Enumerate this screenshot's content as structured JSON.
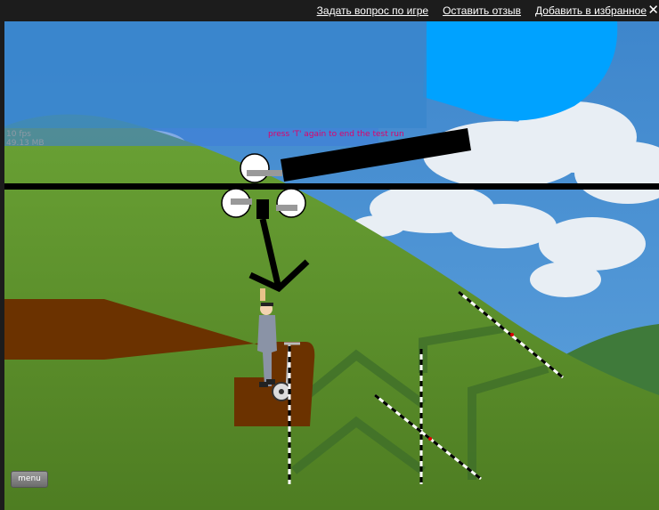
{
  "header": {
    "links": [
      "Задать вопрос по игре",
      "Оставить отзыв",
      "Добавить в избранное"
    ],
    "close_glyph": "✕"
  },
  "hud": {
    "fps": "10 fps",
    "memory": "49.13 MB"
  },
  "hint": "press 'T' again to end the test run",
  "menu_label": "menu",
  "colors": {
    "sky": "#4a8fd0",
    "hill_green": "#5c8e2a",
    "brown_platform": "#6b3200",
    "blue_disc": "#00a2ff",
    "hint_text": "#e0006a"
  }
}
